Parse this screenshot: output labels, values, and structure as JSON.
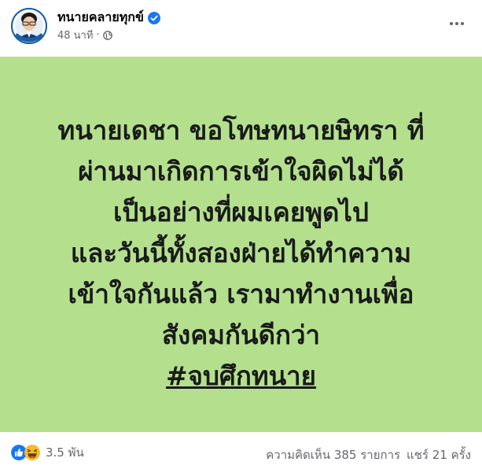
{
  "header": {
    "author_name": "ทนายคลายทุกข์",
    "time": "48 นาที",
    "separator": "·",
    "privacy_icon": "globe-icon",
    "verified_icon": "verified-badge-icon",
    "menu_icon": "more-options-icon"
  },
  "post": {
    "background_color": "#b4e08e",
    "lines": [
      "ทนายเดชา ขอโทษทนายษิทรา ที่",
      "ผ่านมาเกิดการเข้าใจผิดไม่ได้",
      "เป็นอย่างที่ผมเคยพูดไป",
      "และวันนี้ทั้งสองฝ่ายได้ทำความ",
      "เข้าใจกันแล้ว เรามาทำงานเพื่อ",
      "สังคมกันดีกว่า"
    ],
    "hashtag": "#จบศึกทนาย"
  },
  "footer": {
    "reaction_icons": [
      "like-icon",
      "haha-icon"
    ],
    "reaction_count": "3.5 พัน",
    "comments": "ความคิดเห็น 385 รายการ",
    "shares": "แชร์ 21 ครั้ง"
  },
  "colors": {
    "verified": "#1877f2",
    "like": "#1877f2",
    "haha": "#f7b928"
  }
}
